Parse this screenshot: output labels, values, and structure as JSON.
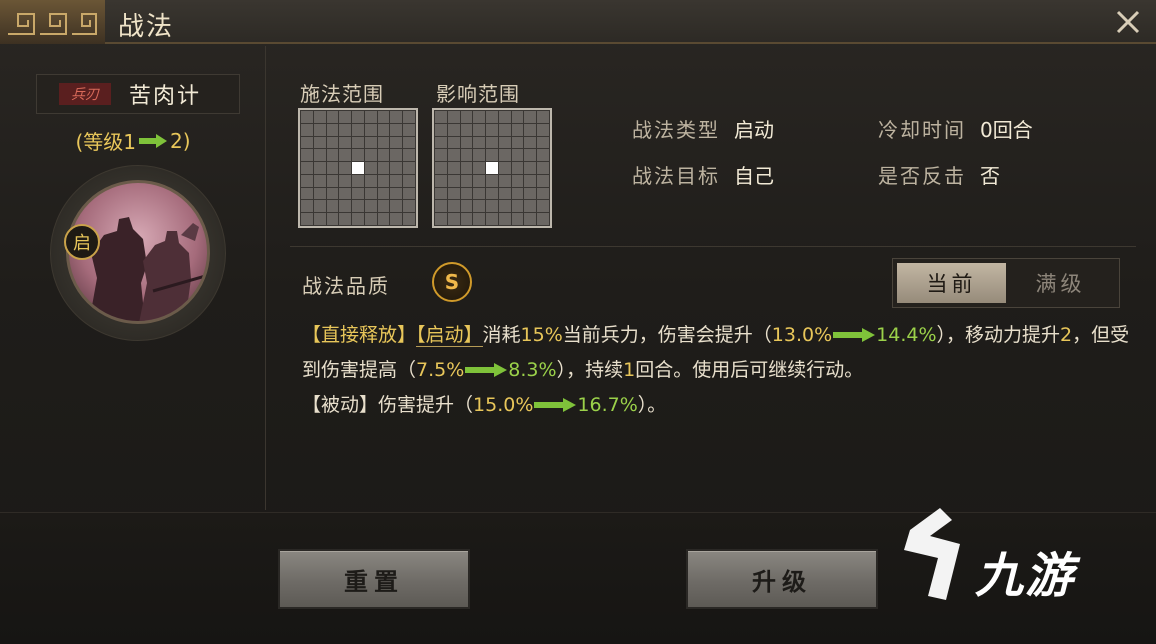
{
  "window": {
    "title": "战法"
  },
  "skill": {
    "type_tag": "兵刃",
    "name": "苦肉计",
    "level_open": "(等级1",
    "level_close": "2)",
    "start_badge": "启"
  },
  "ranges": {
    "cast_label": "施法范围",
    "effect_label": "影响范围"
  },
  "info": {
    "type_key": "战法类型",
    "type_val": "启动",
    "cooldown_key": "冷却时间",
    "cooldown_val": "0回合",
    "target_key": "战法目标",
    "target_val": "自己",
    "counter_key": "是否反击",
    "counter_val": "否"
  },
  "quality": {
    "label": "战法品质",
    "grade": "S"
  },
  "toggle": {
    "current": "当前",
    "max": "满级"
  },
  "desc": {
    "tag1": "【直接释放】",
    "tag2": "【启动】",
    "p1a": "消耗",
    "p1pct": "15%",
    "p1b": "当前兵力，伤害会提升（",
    "v1a": "13.0%",
    "v1b": "14.4%",
    "p1c": "），移动力提升",
    "p1num": "2",
    "p1d": "，但受到伤害提高（",
    "v2a": "7.5%",
    "v2b": "8.3%",
    "p1e": "），持续",
    "p1num2": "1",
    "p1f": "回合。使用后可继续行动。",
    "tag3": "【被动】",
    "p2a": "伤害提升（",
    "v3a": "15.0%",
    "v3b": "16.7%",
    "p2b": "）。"
  },
  "buttons": {
    "reset": "重置",
    "upgrade": "升级"
  },
  "watermark": {
    "text": "九游"
  },
  "colors": {
    "gold": "#e8c65a",
    "green": "#9bd14a",
    "accent_orange": "#d09a2a"
  },
  "icons": [
    "close-icon",
    "arrow-right-icon",
    "ornament-icon",
    "watermark-logo-icon"
  ]
}
